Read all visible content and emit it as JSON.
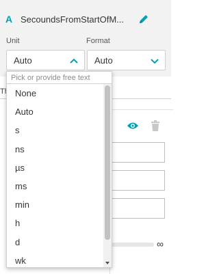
{
  "header": {
    "type_letter": "A",
    "title": "SecoundsFromStartOfM...",
    "edit_icon": "pencil-icon"
  },
  "unit": {
    "label": "Unit",
    "value": "Auto",
    "icon": "chevron-up-icon"
  },
  "format": {
    "label": "Format",
    "value": "Auto",
    "icon": "chevron-down-icon"
  },
  "background": {
    "tab_fragment": "Th",
    "infinity": "∞"
  },
  "dropdown": {
    "placeholder": "Pick or provide free text",
    "options": [
      "None",
      "Auto",
      "s",
      "ns",
      "µs",
      "ms",
      "min",
      "h",
      "d",
      "wk"
    ]
  },
  "colors": {
    "accent": "#00a1b2",
    "panel_bg": "#f2f2f2",
    "text": "#353535"
  }
}
